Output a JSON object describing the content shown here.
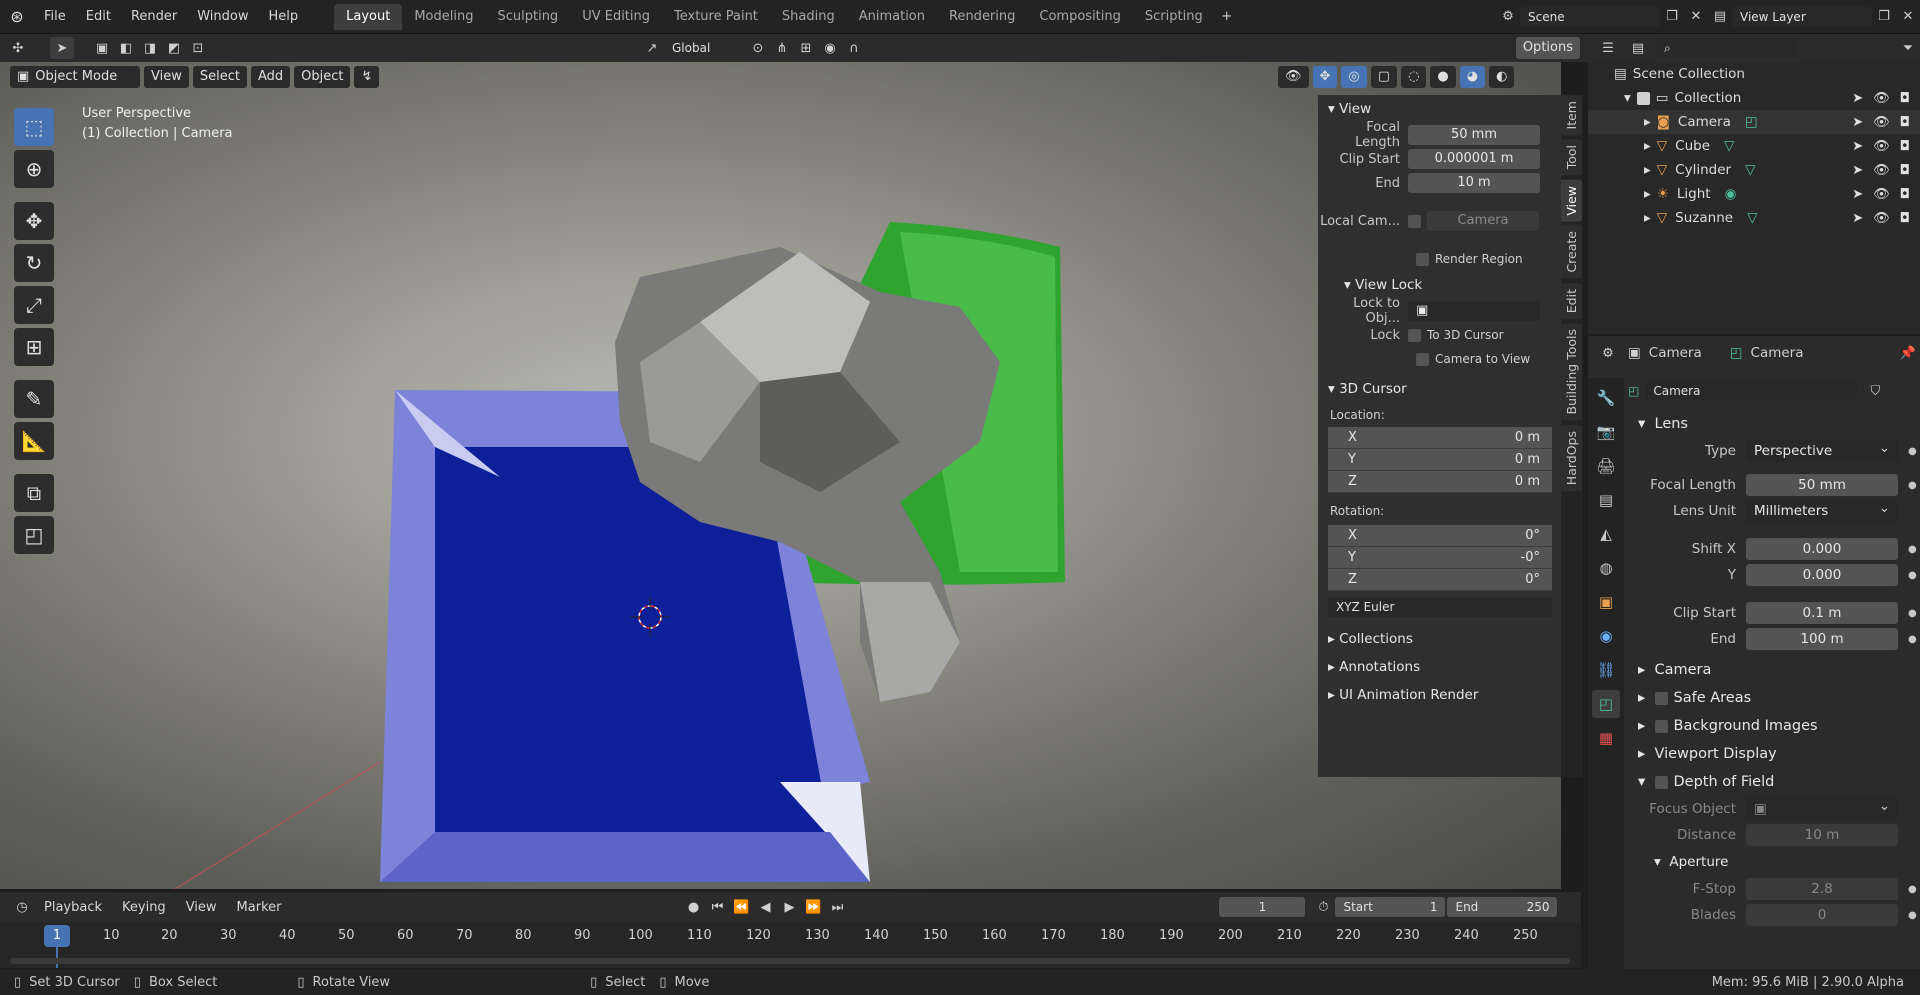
{
  "topbar": {
    "menus": [
      "File",
      "Edit",
      "Render",
      "Window",
      "Help"
    ],
    "workspaces": [
      "Layout",
      "Modeling",
      "Sculpting",
      "UV Editing",
      "Texture Paint",
      "Shading",
      "Animation",
      "Rendering",
      "Compositing",
      "Scripting"
    ],
    "active_workspace": "Layout",
    "scene": "Scene",
    "view_layer": "View Layer"
  },
  "header": {
    "transform_orientation": "Global",
    "options_label": "Options",
    "mode": "Object Mode",
    "menu_view": "View",
    "menu_select": "Select",
    "menu_add": "Add",
    "menu_object": "Object"
  },
  "viewport": {
    "perspective": "User Perspective",
    "context": "(1) Collection | Camera"
  },
  "npanel": {
    "view_title": "View",
    "focal_length_label": "Focal Length",
    "focal_length": "50 mm",
    "clip_start_label": "Clip Start",
    "clip_start": "0.000001 m",
    "end_label": "End",
    "end": "10 m",
    "local_cam_label": "Local Cam...",
    "local_cam_value": "Camera",
    "render_region": "Render Region",
    "view_lock_title": "View Lock",
    "lock_to_obj_label": "Lock to Obj...",
    "lock_label": "Lock",
    "to_3d_cursor": "To 3D Cursor",
    "camera_to_view": "Camera to View",
    "cursor_title": "3D Cursor",
    "location_label": "Location:",
    "loc": [
      {
        "axis": "X",
        "value": "0 m"
      },
      {
        "axis": "Y",
        "value": "0 m"
      },
      {
        "axis": "Z",
        "value": "0 m"
      }
    ],
    "rotation_label": "Rotation:",
    "rot": [
      {
        "axis": "X",
        "value": "0°"
      },
      {
        "axis": "Y",
        "value": "-0°"
      },
      {
        "axis": "Z",
        "value": "0°"
      }
    ],
    "rotation_mode": "XYZ Euler",
    "collections": "Collections",
    "annotations": "Annotations",
    "ui_anim": "UI Animation Render",
    "tabs": [
      "Item",
      "Tool",
      "View",
      "Create",
      "Edit",
      "Building Tools",
      "HardOps"
    ],
    "active_tab": "View"
  },
  "outliner": {
    "root": "Scene Collection",
    "collection": "Collection",
    "items": [
      "Camera",
      "Cube",
      "Cylinder",
      "Light",
      "Suzanne"
    ]
  },
  "properties": {
    "breadcrumb_object": "Camera",
    "breadcrumb_data": "Camera",
    "datablock": "Camera",
    "lens_title": "Lens",
    "type_label": "Type",
    "type_value": "Perspective",
    "focal_label": "Focal Length",
    "focal_value": "50 mm",
    "lens_unit_label": "Lens Unit",
    "lens_unit_value": "Millimeters",
    "shift_x_label": "Shift X",
    "shift_x": "0.000",
    "shift_y_label": "Y",
    "shift_y": "0.000",
    "clip_start_label": "Clip Start",
    "clip_start": "0.1 m",
    "clip_end_label": "End",
    "clip_end": "100 m",
    "sections": [
      "Camera",
      "Safe Areas",
      "Background Images",
      "Viewport Display",
      "Depth of Field"
    ],
    "focus_object_label": "Focus Object",
    "distance_label": "Distance",
    "distance": "10 m",
    "aperture_title": "Aperture",
    "fstop_label": "F-Stop",
    "fstop": "2.8",
    "blades_label": "Blades",
    "blades": "0"
  },
  "timeline": {
    "menus": [
      "Playback",
      "Keying",
      "View",
      "Marker"
    ],
    "current_frame": "1",
    "start_label": "Start",
    "start": "1",
    "end_label": "End",
    "end": "250",
    "frames": [
      "10",
      "20",
      "30",
      "40",
      "50",
      "60",
      "70",
      "80",
      "90",
      "100",
      "110",
      "120",
      "130",
      "140",
      "150",
      "160",
      "170",
      "180",
      "190",
      "200",
      "210",
      "220",
      "230",
      "240",
      "250"
    ]
  },
  "status": {
    "hint1": "Set 3D Cursor",
    "hint2": "Box Select",
    "hint3": "Rotate View",
    "hint4": "Select",
    "hint5": "Move",
    "info": "Mem: 95.6 MiB | 2.90.0 Alpha"
  }
}
